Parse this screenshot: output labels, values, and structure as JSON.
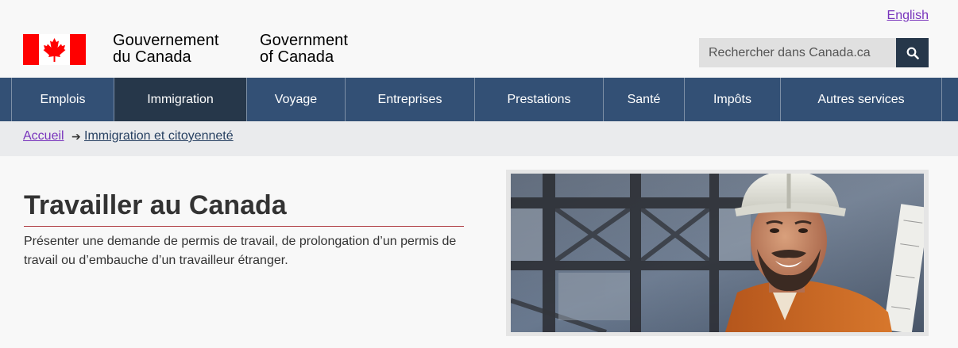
{
  "header": {
    "language_link": "English",
    "signature_fr": [
      "Gouvernement",
      "du Canada"
    ],
    "signature_en": [
      "Government",
      "of Canada"
    ],
    "search": {
      "placeholder": "Rechercher dans Canada.ca"
    }
  },
  "menu": {
    "items": [
      {
        "label": "Emplois"
      },
      {
        "label": "Immigration",
        "active": true
      },
      {
        "label": "Voyage"
      },
      {
        "label": "Entreprises"
      },
      {
        "label": "Prestations"
      },
      {
        "label": "Santé"
      },
      {
        "label": "Impôts"
      },
      {
        "label": "Autres services"
      }
    ]
  },
  "breadcrumb": {
    "home": "Accueil",
    "current": "Immigration et citoyenneté"
  },
  "main": {
    "title": "Travailler au Canada",
    "lead": "Présenter une demande de permis de travail, de prolongation d’un permis de travail ou d’embauche d’un travailleur étranger."
  },
  "colors": {
    "menu_bg": "#335075",
    "menu_active": "#26374a",
    "link_visited": "#7834bc",
    "title_rule": "#af3c43",
    "flag_red": "#ff0000"
  }
}
